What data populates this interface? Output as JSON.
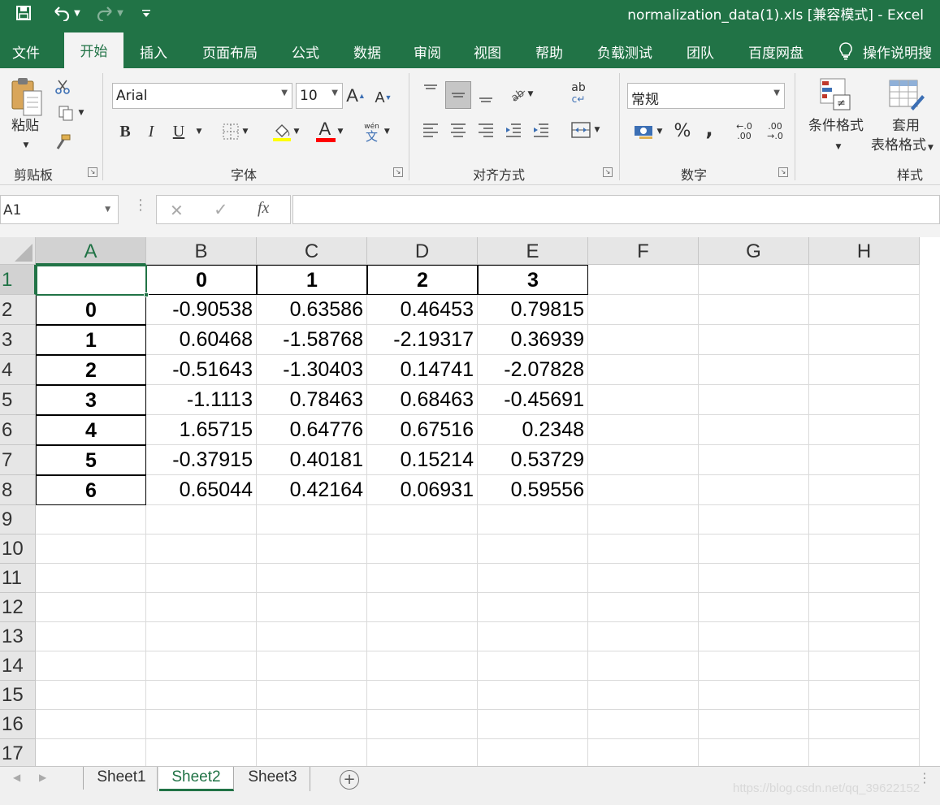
{
  "window": {
    "title": "normalization_data(1).xls  [兼容模式]  -  Excel"
  },
  "qat": {
    "save_icon": "save-icon",
    "undo_icon": "undo-icon",
    "redo_icon": "redo-icon",
    "customize_icon": "customize-qat-icon"
  },
  "ribbon_tabs": [
    "文件",
    "开始",
    "插入",
    "页面布局",
    "公式",
    "数据",
    "审阅",
    "视图",
    "帮助",
    "负载测试",
    "团队",
    "百度网盘"
  ],
  "active_tab": "开始",
  "tell_me": "操作说明搜",
  "clipboard": {
    "paste_label": "粘贴",
    "group_label": "剪贴板"
  },
  "font": {
    "name": "Arial",
    "size": "10",
    "group_label": "字体",
    "phonetic_label": "wén",
    "phonetic_char": "文",
    "bold": "B",
    "italic": "I",
    "underline": "U",
    "grow": "A",
    "shrink": "A",
    "font_color_letter": "A",
    "highlight_color": "#ffff00",
    "font_color": "#ff0000"
  },
  "alignment": {
    "group_label": "对齐方式",
    "wrap_label": "ab"
  },
  "number": {
    "format": "常规",
    "group_label": "数字",
    "percent": "%",
    "comma": ",",
    "inc_decimal": "←.0 .00",
    "dec_decimal": ".00 →.0"
  },
  "styles": {
    "conditional_label": "条件格式",
    "table_label_1": "套用",
    "table_label_2": "表格格式",
    "group_label": "样式"
  },
  "formula_bar": {
    "name_box": "A1",
    "cancel": "✕",
    "enter": "✓",
    "fx": "fx",
    "value": ""
  },
  "columns": [
    "A",
    "B",
    "C",
    "D",
    "E",
    "F",
    "G",
    "H"
  ],
  "rows": [
    "1",
    "2",
    "3",
    "4",
    "5",
    "6",
    "7",
    "8",
    "9",
    "10",
    "11",
    "12",
    "13",
    "14",
    "15",
    "16",
    "17"
  ],
  "header_row": [
    "",
    "0",
    "1",
    "2",
    "3"
  ],
  "data_rows": [
    {
      "index": "0",
      "values": [
        "-0.90538",
        "0.63586",
        "0.46453",
        "0.79815"
      ]
    },
    {
      "index": "1",
      "values": [
        "0.60468",
        "-1.58768",
        "-2.19317",
        "0.36939"
      ]
    },
    {
      "index": "2",
      "values": [
        "-0.51643",
        "-1.30403",
        "0.14741",
        "-2.07828"
      ]
    },
    {
      "index": "3",
      "values": [
        "-1.1113",
        "0.78463",
        "0.68463",
        "-0.45691"
      ]
    },
    {
      "index": "4",
      "values": [
        "1.65715",
        "0.64776",
        "0.67516",
        "0.2348"
      ]
    },
    {
      "index": "5",
      "values": [
        "-0.37915",
        "0.40181",
        "0.15214",
        "0.53729"
      ]
    },
    {
      "index": "6",
      "values": [
        "0.65044",
        "0.42164",
        "0.06931",
        "0.59556"
      ]
    }
  ],
  "sheets": [
    "Sheet1",
    "Sheet2",
    "Sheet3"
  ],
  "active_sheet": "Sheet2",
  "accent_color": "#217346",
  "watermark": "https://blog.csdn.net/qq_39622152"
}
